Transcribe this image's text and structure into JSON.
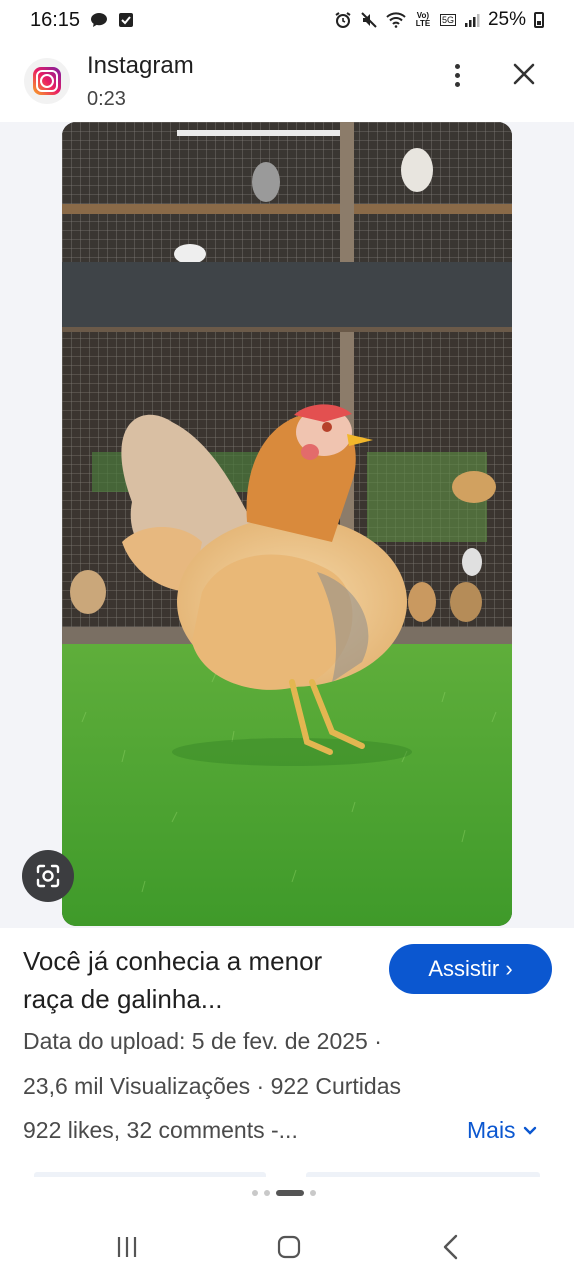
{
  "status_bar": {
    "time": "16:15",
    "battery_text": "25%",
    "left_icons": [
      "chat-bubble-icon",
      "checkbox-icon"
    ],
    "right_icons": [
      "alarm-icon",
      "mute-icon",
      "wifi-icon",
      "volte-icon",
      "5g-icon",
      "signal-icon",
      "battery-icon"
    ],
    "volte_label": "Vo) LTE",
    "fiveg_label": "5G"
  },
  "header": {
    "app_name": "Instagram",
    "duration": "0:23",
    "icon": "instagram-icon"
  },
  "video": {
    "description": "chicken-on-grass"
  },
  "info": {
    "title": "Você já conhecia a menor raça de galinha...",
    "watch_button": "Assistir ›",
    "upload_line": "Data do upload: 5 de fev. de 2025 ·",
    "stats_line": "23,6 mil Visualizações · 922 Curtidas",
    "comments_line": "922 likes, 32 comments -...",
    "more_button": "Mais"
  },
  "colors": {
    "accent": "#0b57d0",
    "media_bg": "#f3f4f8",
    "lens_bg": "#3c3d40"
  },
  "nav": {
    "icons": [
      "recent-apps-icon",
      "home-icon",
      "back-icon"
    ]
  }
}
